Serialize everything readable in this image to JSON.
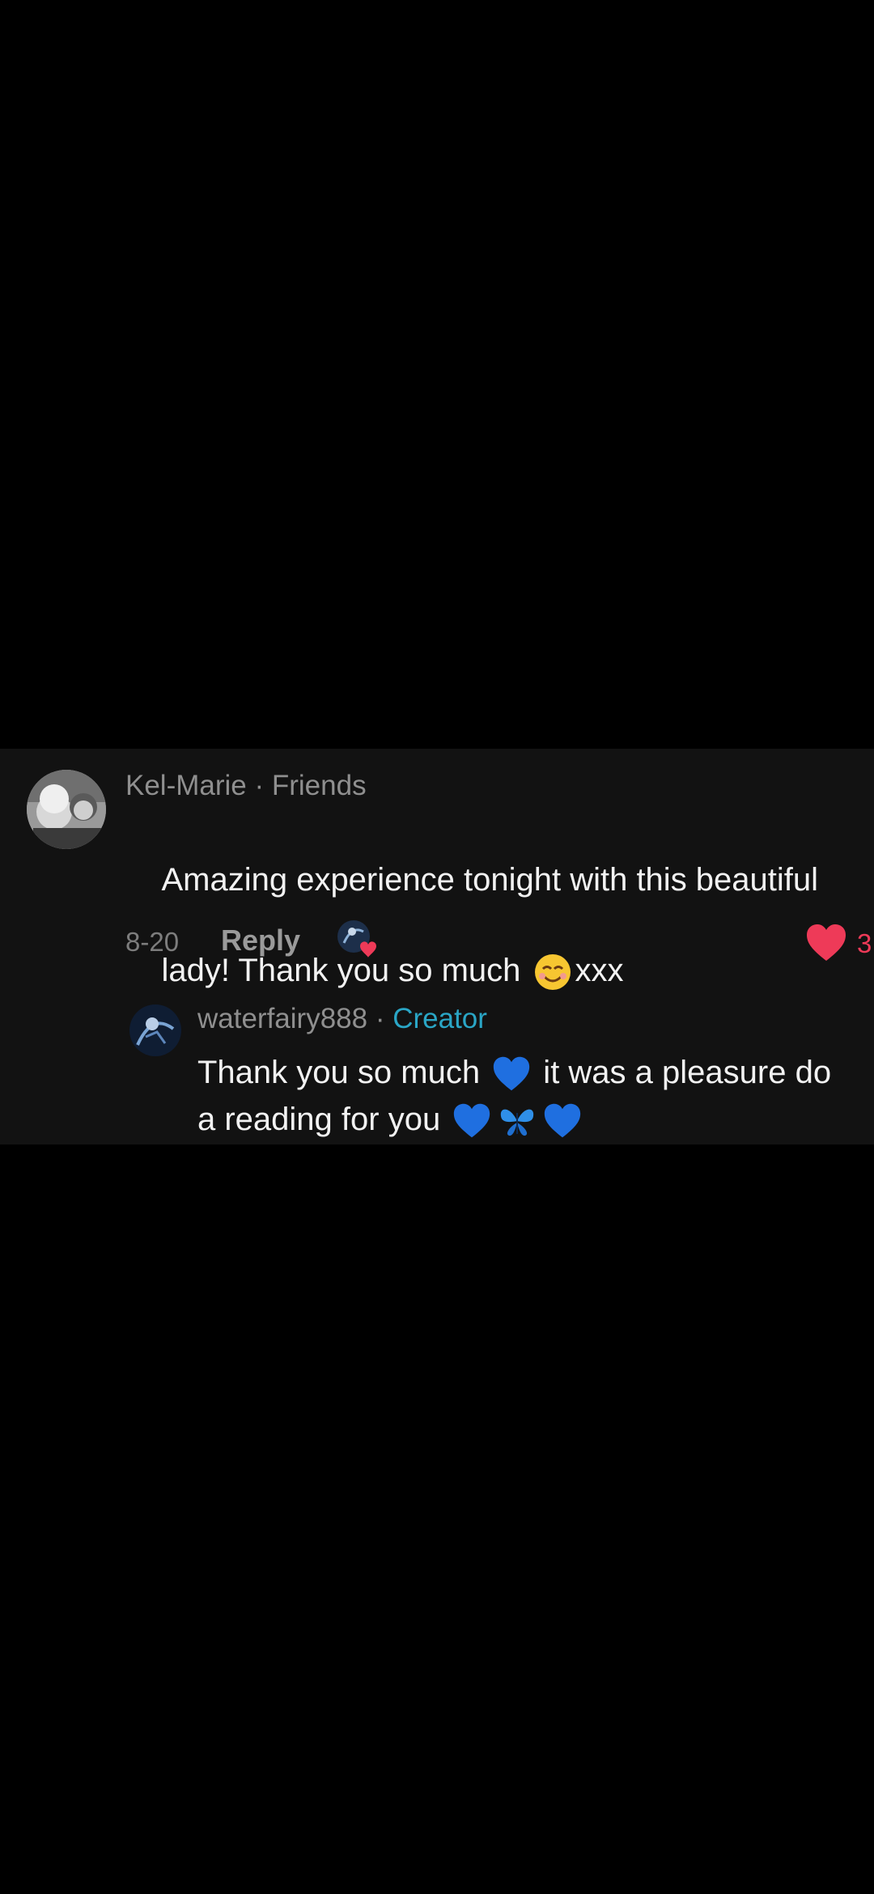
{
  "comment": {
    "username": "Kel-Marie",
    "separator": " · ",
    "relation": "Friends",
    "text_line1": "Amazing experience tonight with this beautiful",
    "text_line2_before": "lady! Thank you so much ",
    "text_line2_after": "xxx",
    "date": "8-20",
    "reply_label": "Reply",
    "like_count": "3",
    "liked": true,
    "creator_liked": true
  },
  "reply": {
    "username": "waterfairy888",
    "separator": " · ",
    "badge": "Creator",
    "text_line1_a": "Thank you so much ",
    "text_line1_b": " it was a pleasure do",
    "text_line2": "a reading for you "
  },
  "colors": {
    "background": "#000000",
    "card": "#121212",
    "like_red": "#ee3a58",
    "creator_blue": "#2aa6c6"
  },
  "icons": {
    "smile": "smiling-face-emoji",
    "blue_heart": "blue-heart-emoji",
    "butterfly": "butterfly-emoji",
    "heart": "heart-icon"
  }
}
